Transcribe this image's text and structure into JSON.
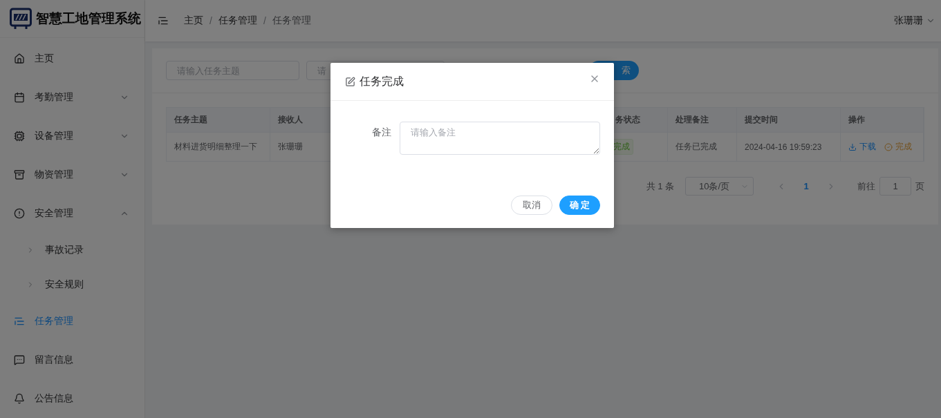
{
  "app": {
    "title": "智慧工地管理系统"
  },
  "header": {
    "breadcrumb": [
      "主页",
      "任务管理",
      "任务管理"
    ],
    "separator": "/",
    "user": "张珊珊"
  },
  "sidebar": {
    "items": [
      {
        "label": "主页",
        "selected": false
      },
      {
        "label": "考勤管理",
        "selected": false,
        "expanded": false
      },
      {
        "label": "设备管理",
        "selected": false,
        "expanded": false
      },
      {
        "label": "物资管理",
        "selected": false,
        "expanded": false
      },
      {
        "label": "安全管理",
        "selected": false,
        "expanded": true,
        "children": [
          {
            "label": "事故记录",
            "selected": false
          },
          {
            "label": "安全规则",
            "selected": false
          }
        ]
      },
      {
        "label": "任务管理",
        "selected": true
      },
      {
        "label": "留言信息",
        "selected": false
      },
      {
        "label": "公告信息",
        "selected": false
      }
    ]
  },
  "search": {
    "fields": [
      {
        "placeholder": "请输入任务主题"
      },
      {
        "placeholder": "请"
      }
    ],
    "button": "索"
  },
  "table": {
    "columns": [
      "任务主题",
      "接收人",
      "务状态",
      "处理备注",
      "提交时间",
      "操作"
    ],
    "rows": [
      {
        "subject": "材料进货明细整理一下",
        "receiver": "张珊珊",
        "status": "完成",
        "remark": "任务已完成",
        "time": "2024-04-16 19:59:23",
        "actions": [
          {
            "label": "下载",
            "kind": "download"
          },
          {
            "label": "完成",
            "kind": "complete"
          }
        ]
      }
    ]
  },
  "pagination": {
    "total": "共 1 条",
    "page_size": "10条/页",
    "pages": [
      {
        "label": "1",
        "selected": true
      }
    ],
    "goto_label": "前往",
    "goto_value": "1",
    "goto_suffix": "页"
  },
  "dialog": {
    "title": "任务完成",
    "field_label": "备注",
    "placeholder": "请输入备注",
    "buttons": [
      {
        "label": "取消",
        "kind": "secondary"
      },
      {
        "label": "确 定",
        "kind": "primary"
      }
    ]
  }
}
